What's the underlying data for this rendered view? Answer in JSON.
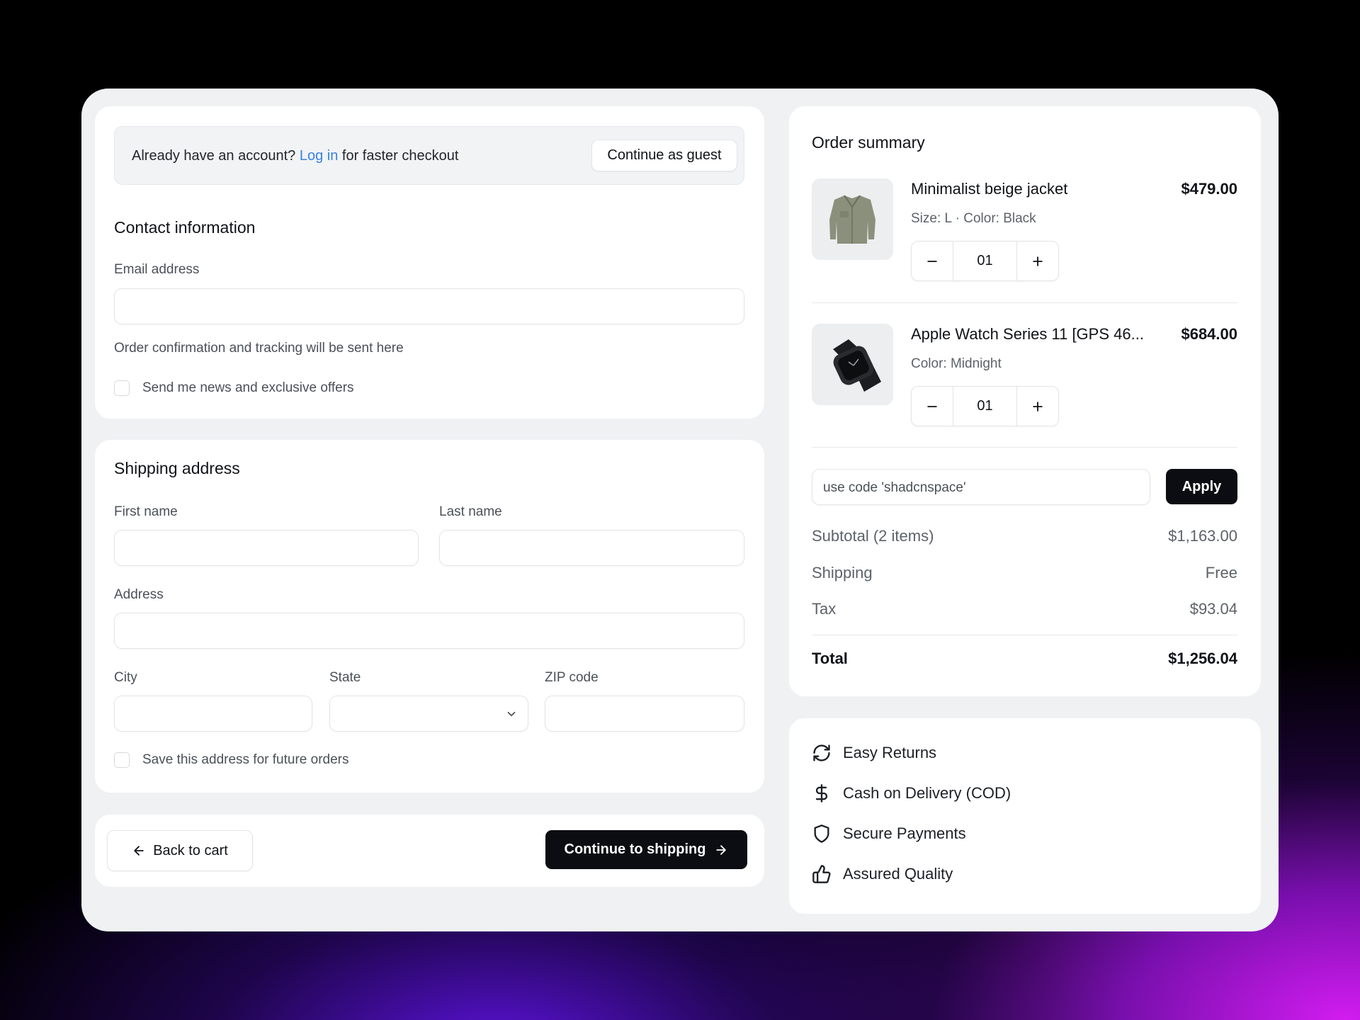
{
  "account_banner": {
    "prefix": "Already have an account?",
    "login_link": "Log in",
    "suffix": "for faster checkout",
    "guest_button": "Continue as guest"
  },
  "contact": {
    "title": "Contact information",
    "email_label": "Email address",
    "email_value": "",
    "email_help": "Order confirmation and tracking will be sent here",
    "newsletter_label": "Send me news and exclusive offers",
    "newsletter_checked": false
  },
  "shipping": {
    "title": "Shipping address",
    "first_name_label": "First name",
    "last_name_label": "Last name",
    "address_label": "Address",
    "city_label": "City",
    "state_label": "State",
    "state_value": "",
    "zip_label": "ZIP code",
    "save_label": "Save this address for future orders",
    "save_checked": false
  },
  "nav": {
    "back_label": "Back to cart",
    "continue_label": "Continue to shipping"
  },
  "summary": {
    "title": "Order summary",
    "items": [
      {
        "name": "Minimalist beige jacket",
        "meta": "Size: L · Color: Black",
        "price": "$479.00",
        "qty": "01",
        "image": "jacket-image"
      },
      {
        "name": "Apple Watch Series 11 [GPS 46...",
        "meta": "Color: Midnight",
        "price": "$684.00",
        "qty": "01",
        "image": "watch-image"
      }
    ],
    "promo_placeholder": "use code 'shadcnspace'",
    "apply_label": "Apply",
    "subtotal_label": "Subtotal (2 items)",
    "subtotal_value": "$1,163.00",
    "shipping_label": "Shipping",
    "shipping_value": "Free",
    "tax_label": "Tax",
    "tax_value": "$93.04",
    "total_label": "Total",
    "total_value": "$1,256.04"
  },
  "perks": [
    {
      "label": "Easy Returns",
      "icon": "refresh-icon"
    },
    {
      "label": "Cash on Delivery (COD)",
      "icon": "dollar-icon"
    },
    {
      "label": "Secure Payments",
      "icon": "shield-icon"
    },
    {
      "label": "Assured Quality",
      "icon": "thumbs-up-icon"
    }
  ],
  "colors": {
    "accent_link": "#3b82e0",
    "primary_button": "#0b0d12",
    "panel_bg": "#eff1f3",
    "card_bg": "#ffffff"
  }
}
